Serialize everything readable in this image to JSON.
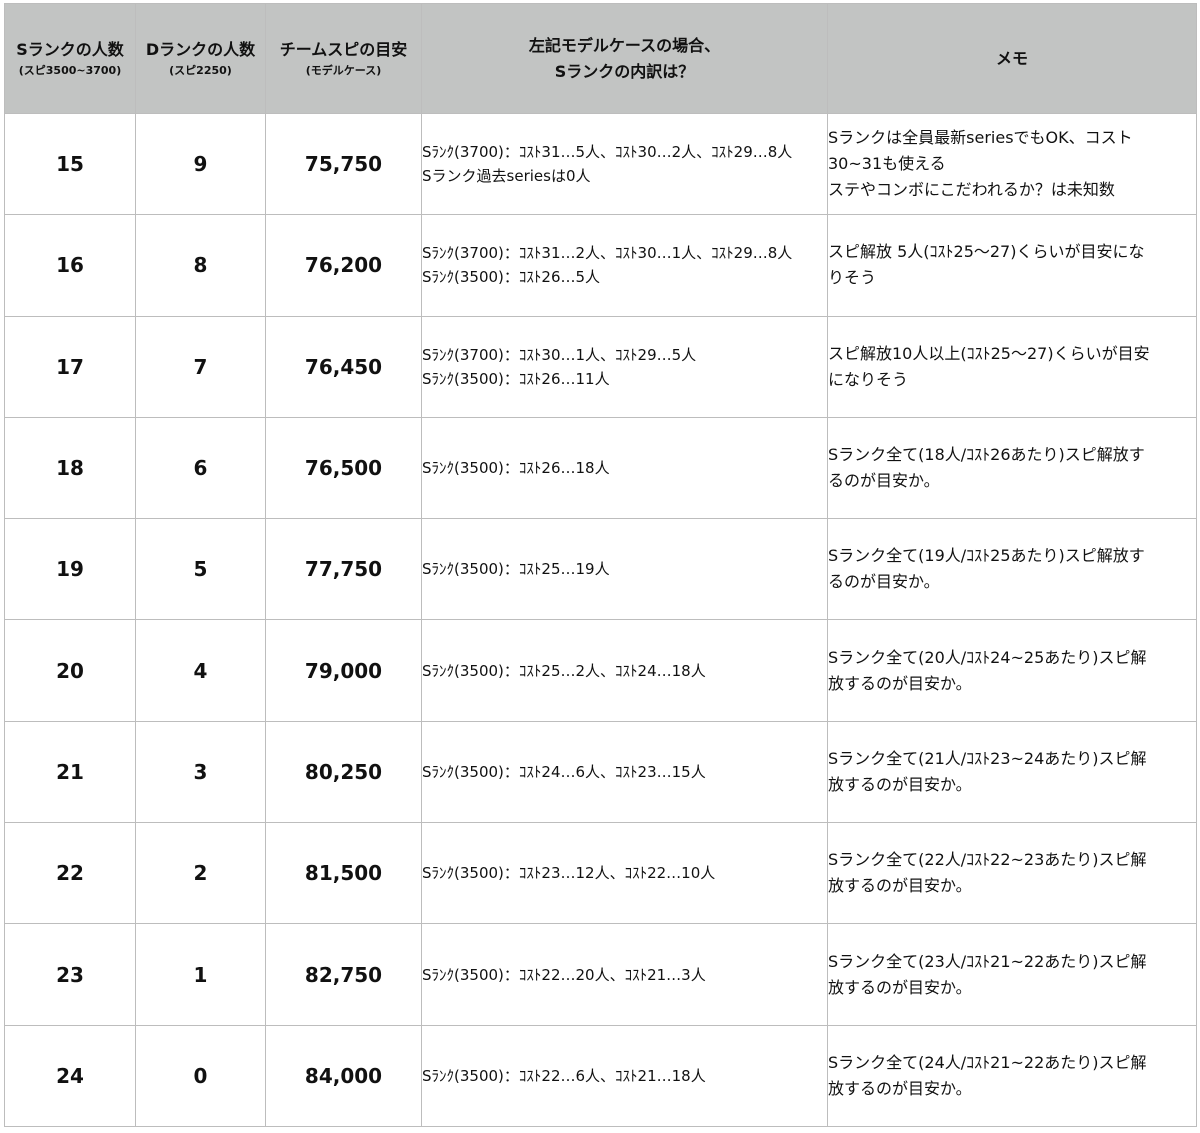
{
  "headers": {
    "s_rank": {
      "main": "Sランクの人数",
      "sub": "(スピ3500~3700)"
    },
    "d_rank": {
      "main": "Dランクの人数",
      "sub": "(スピ2250)"
    },
    "team_spi": {
      "main": "チームスピの目安",
      "sub": "(モデルケース)"
    },
    "breakdown": {
      "line1": "左記モデルケースの場合、",
      "line2": "Sランクの内訳は？"
    },
    "memo": {
      "main": "メモ"
    }
  },
  "rows": [
    {
      "s": "15",
      "d": "9",
      "spi": "75,750",
      "breakdown": [
        "Sﾗﾝｸ(3700)：ｺｽﾄ31…5人、ｺｽﾄ30…2人、ｺｽﾄ29…8人",
        "Sランク過去seriesは0人"
      ],
      "memo": [
        "Sランクは全員最新seriesでもOK、コスト",
        "30~31も使える",
        "ステやコンボにこだわれるか？は未知数"
      ]
    },
    {
      "s": "16",
      "d": "8",
      "spi": "76,200",
      "breakdown": [
        "Sﾗﾝｸ(3700)：ｺｽﾄ31…2人、ｺｽﾄ30…1人、ｺｽﾄ29…8人",
        "Sﾗﾝｸ(3500)：ｺｽﾄ26…5人"
      ],
      "memo": [
        "スピ解放 5人(ｺｽﾄ25～27)くらいが目安にな",
        "りそう"
      ]
    },
    {
      "s": "17",
      "d": "7",
      "spi": "76,450",
      "breakdown": [
        "Sﾗﾝｸ(3700)：ｺｽﾄ30…1人、ｺｽﾄ29…5人",
        "Sﾗﾝｸ(3500)：ｺｽﾄ26…11人"
      ],
      "memo": [
        "スピ解放10人以上(ｺｽﾄ25～27)くらいが目安",
        "になりそう"
      ]
    },
    {
      "s": "18",
      "d": "6",
      "spi": "76,500",
      "breakdown": [
        "Sﾗﾝｸ(3500)：ｺｽﾄ26…18人"
      ],
      "memo": [
        "Sランク全て(18人/ｺｽﾄ26あたり)スピ解放す",
        "るのが目安か。"
      ]
    },
    {
      "s": "19",
      "d": "5",
      "spi": "77,750",
      "breakdown": [
        "Sﾗﾝｸ(3500)：ｺｽﾄ25…19人"
      ],
      "memo": [
        "Sランク全て(19人/ｺｽﾄ25あたり)スピ解放す",
        "るのが目安か。"
      ]
    },
    {
      "s": "20",
      "d": "4",
      "spi": "79,000",
      "breakdown": [
        "Sﾗﾝｸ(3500)：ｺｽﾄ25…2人、ｺｽﾄ24…18人"
      ],
      "memo": [
        "Sランク全て(20人/ｺｽﾄ24~25あたり)スピ解",
        "放するのが目安か。"
      ]
    },
    {
      "s": "21",
      "d": "3",
      "spi": "80,250",
      "breakdown": [
        "Sﾗﾝｸ(3500)：ｺｽﾄ24…6人、ｺｽﾄ23…15人"
      ],
      "memo": [
        "Sランク全て(21人/ｺｽﾄ23~24あたり)スピ解",
        "放するのが目安か。"
      ]
    },
    {
      "s": "22",
      "d": "2",
      "spi": "81,500",
      "breakdown": [
        "Sﾗﾝｸ(3500)：ｺｽﾄ23…12人、ｺｽﾄ22…10人"
      ],
      "memo": [
        "Sランク全て(22人/ｺｽﾄ22~23あたり)スピ解",
        "放するのが目安か。"
      ]
    },
    {
      "s": "23",
      "d": "1",
      "spi": "82,750",
      "breakdown": [
        "Sﾗﾝｸ(3500)：ｺｽﾄ22…20人、ｺｽﾄ21…3人"
      ],
      "memo": [
        "Sランク全て(23人/ｺｽﾄ21~22あたり)スピ解",
        "放するのが目安か。"
      ]
    },
    {
      "s": "24",
      "d": "0",
      "spi": "84,000",
      "breakdown": [
        "Sﾗﾝｸ(3500)：ｺｽﾄ22…6人、ｺｽﾄ21…18人"
      ],
      "memo": [
        "Sランク全て(24人/ｺｽﾄ21~22あたり)スピ解",
        "放するのが目安か。"
      ]
    }
  ]
}
